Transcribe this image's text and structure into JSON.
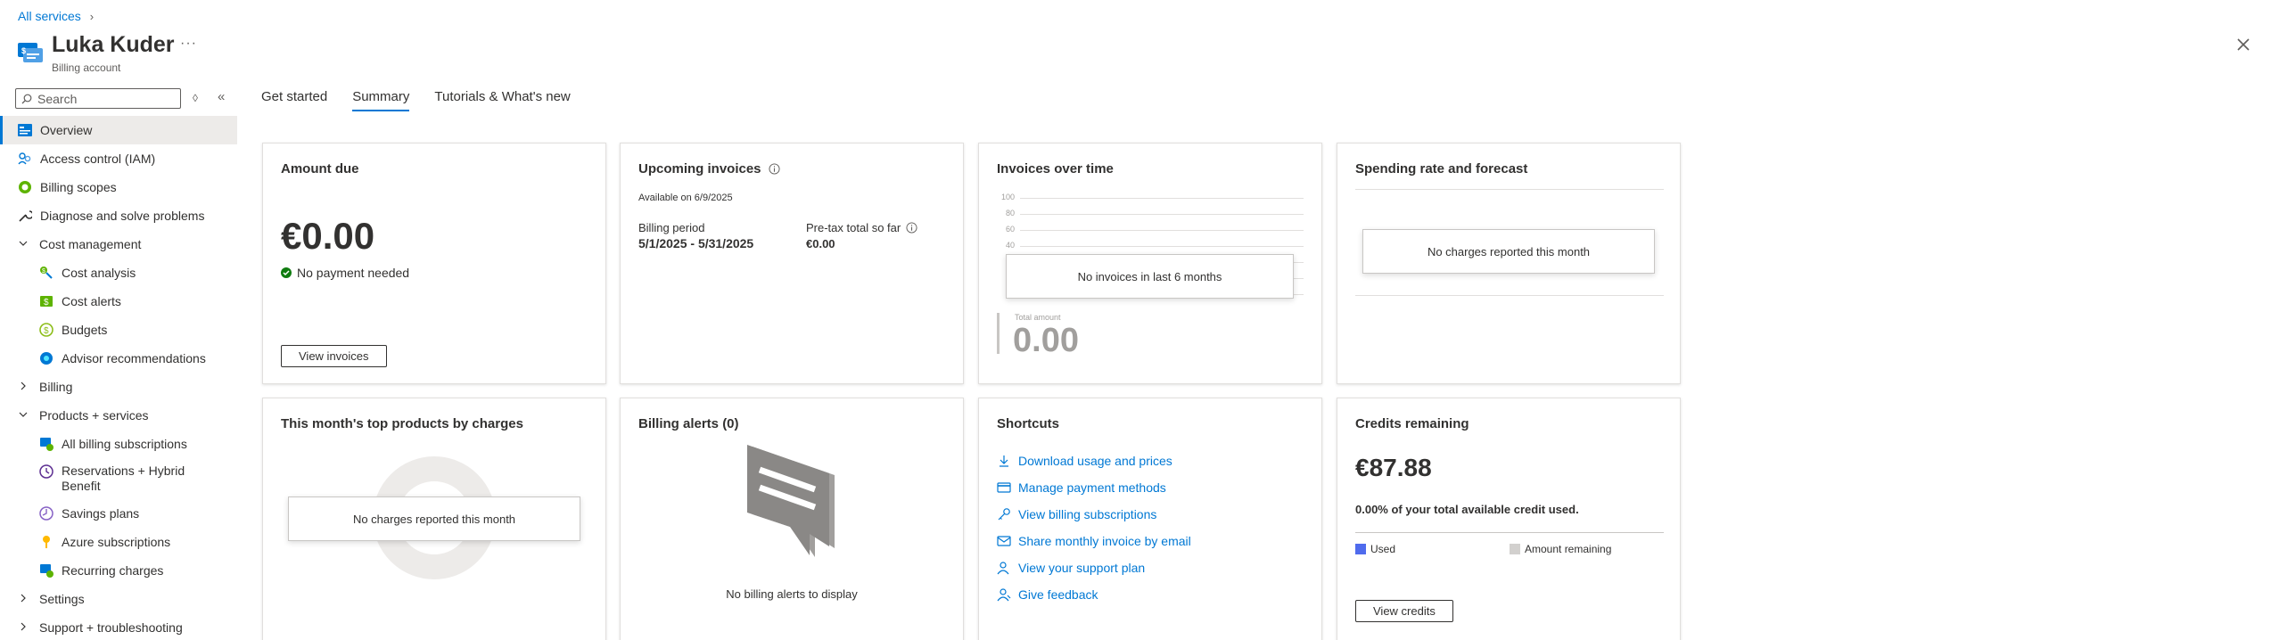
{
  "breadcrumb": {
    "root": "All services"
  },
  "header": {
    "title": "Luka Kuder",
    "subtitle": "Billing account",
    "more": "···"
  },
  "sidebar": {
    "search_placeholder": "Search",
    "count": "◊",
    "collapse": "«",
    "items": [
      {
        "label": "Overview"
      },
      {
        "label": "Access control (IAM)"
      },
      {
        "label": "Billing scopes"
      },
      {
        "label": "Diagnose and solve problems"
      },
      {
        "label": "Cost management"
      },
      {
        "label": "Cost analysis"
      },
      {
        "label": "Cost alerts"
      },
      {
        "label": "Budgets"
      },
      {
        "label": "Advisor recommendations"
      },
      {
        "label": "Billing"
      },
      {
        "label": "Products + services"
      },
      {
        "label": "All billing subscriptions"
      },
      {
        "label": "Reservations + Hybrid Benefit"
      },
      {
        "label": "Savings plans"
      },
      {
        "label": "Azure subscriptions"
      },
      {
        "label": "Recurring charges"
      },
      {
        "label": "Settings"
      },
      {
        "label": "Support + troubleshooting"
      }
    ]
  },
  "tabs": [
    {
      "label": "Get started"
    },
    {
      "label": "Summary"
    },
    {
      "label": "Tutorials & What's new"
    }
  ],
  "cards": {
    "amount_due": {
      "title": "Amount due",
      "amount": "€0.00",
      "status": "No payment needed",
      "button": "View invoices"
    },
    "upcoming": {
      "title": "Upcoming invoices",
      "available": "Available on 6/9/2025",
      "period_label": "Billing period",
      "period_value": "5/1/2025 - 5/31/2025",
      "pretax_label": "Pre-tax total so far",
      "pretax_value": "€0.00"
    },
    "invoices_time": {
      "title": "Invoices over time",
      "y_ticks": [
        "100",
        "80",
        "60",
        "40"
      ],
      "empty": "No invoices in last 6 months",
      "total_label": "Total amount",
      "total_value": "0.00"
    },
    "spending": {
      "title": "Spending rate and forecast",
      "empty": "No charges reported this month"
    },
    "top_products": {
      "title": "This month's top products by charges",
      "empty": "No charges reported this month"
    },
    "alerts": {
      "title": "Billing alerts (0)",
      "empty": "No billing alerts to display"
    },
    "shortcuts": {
      "title": "Shortcuts",
      "links": [
        {
          "label": "Download usage and prices",
          "icon": "download-icon"
        },
        {
          "label": "Manage payment methods",
          "icon": "payment-icon"
        },
        {
          "label": "View billing subscriptions",
          "icon": "key-icon"
        },
        {
          "label": "Share monthly invoice by email",
          "icon": "mail-icon"
        },
        {
          "label": "View your support plan",
          "icon": "support-icon"
        },
        {
          "label": "Give feedback",
          "icon": "feedback-icon"
        }
      ]
    },
    "credits": {
      "title": "Credits remaining",
      "amount": "€87.88",
      "used_text": "0.00% of your total available credit used.",
      "legend_used": "Used",
      "legend_remaining": "Amount remaining",
      "button": "View credits",
      "used_color": "#4f6bed",
      "remaining_color": "#d2d0ce"
    }
  },
  "colors": {
    "accent": "#0078d4",
    "success": "#107c10"
  }
}
